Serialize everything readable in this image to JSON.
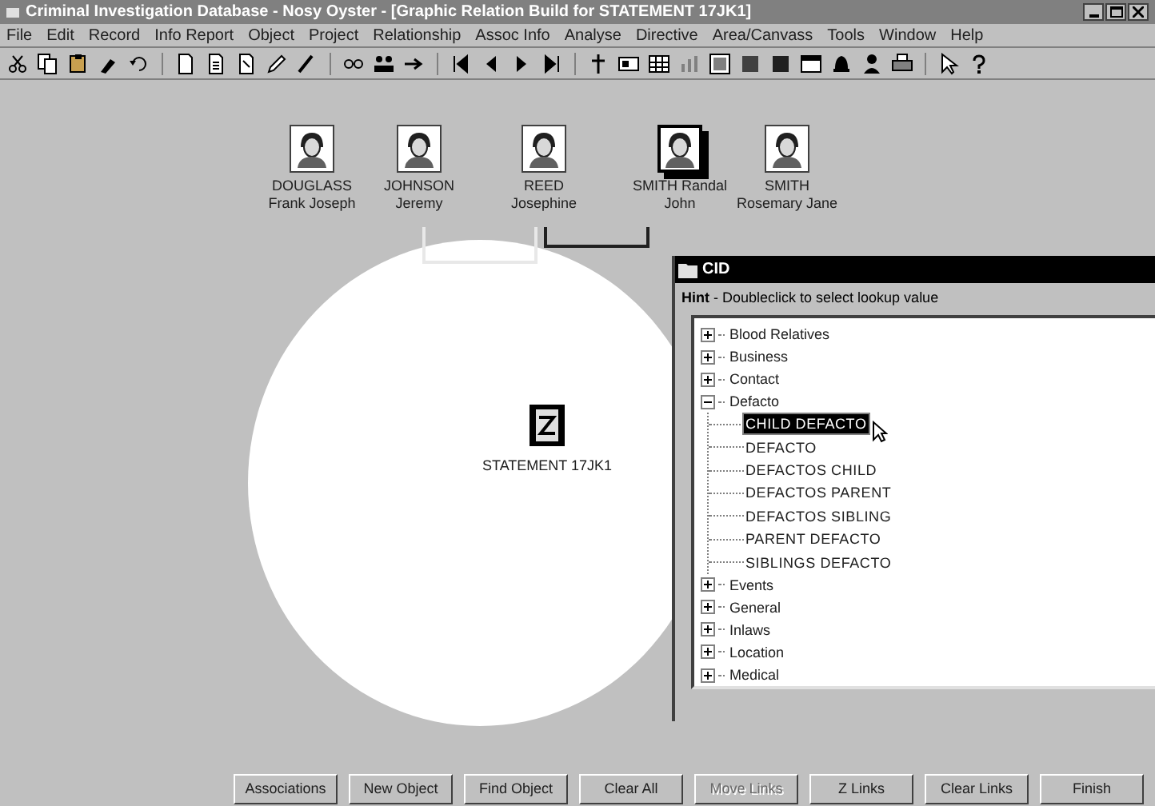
{
  "window": {
    "title": "Criminal Investigation Database - Nosy Oyster - [Graphic Relation Build for STATEMENT 17JK1]"
  },
  "menu": [
    "File",
    "Edit",
    "Record",
    "Info Report",
    "Object",
    "Project",
    "Relationship",
    "Assoc Info",
    "Analyse",
    "Directive",
    "Area/Canvass",
    "Tools",
    "Window",
    "Help"
  ],
  "persons": [
    {
      "surname": "DOUGLASS",
      "given": "Frank Joseph",
      "selected": false
    },
    {
      "surname": "JOHNSON",
      "given": "Jeremy",
      "selected": false
    },
    {
      "surname": "REED",
      "given": "Josephine",
      "selected": false
    },
    {
      "surname": "SMITH Randal",
      "given": "John",
      "selected": true
    },
    {
      "surname": "SMITH",
      "given": "Rosemary Jane",
      "selected": false
    }
  ],
  "statement": {
    "label": "STATEMENT 17JK1"
  },
  "dialog": {
    "title": "CID",
    "hint_label": "Hint",
    "hint": " - Doubleclick to select lookup value",
    "tree": [
      {
        "label": "Blood Relatives",
        "expanded": false,
        "selected": false
      },
      {
        "label": "Business",
        "expanded": false,
        "selected": false
      },
      {
        "label": "Contact",
        "expanded": false,
        "selected": false
      },
      {
        "label": "Defacto",
        "expanded": true,
        "selected": false,
        "children": [
          {
            "label": "CHILD DEFACTO",
            "selected": true
          },
          {
            "label": "DEFACTO",
            "selected": false
          },
          {
            "label": "DEFACTOS CHILD",
            "selected": false
          },
          {
            "label": "DEFACTOS PARENT",
            "selected": false
          },
          {
            "label": "DEFACTOS SIBLING",
            "selected": false
          },
          {
            "label": "PARENT DEFACTO",
            "selected": false
          },
          {
            "label": "SIBLINGS DEFACTO",
            "selected": false
          }
        ]
      },
      {
        "label": "Events",
        "expanded": false,
        "selected": false
      },
      {
        "label": "General",
        "expanded": false,
        "selected": false
      },
      {
        "label": "Inlaws",
        "expanded": false,
        "selected": false
      },
      {
        "label": "Location",
        "expanded": false,
        "selected": false
      },
      {
        "label": "Medical",
        "expanded": false,
        "selected": false
      }
    ]
  },
  "buttons": [
    {
      "label": "Associations",
      "disabled": false
    },
    {
      "label": "New Object",
      "disabled": false
    },
    {
      "label": "Find Object",
      "disabled": false
    },
    {
      "label": "Clear All",
      "disabled": false
    },
    {
      "label": "Move Links",
      "disabled": true
    },
    {
      "label": "Z Links",
      "disabled": false
    },
    {
      "label": "Clear Links",
      "disabled": false
    },
    {
      "label": "Finish",
      "disabled": false
    }
  ]
}
